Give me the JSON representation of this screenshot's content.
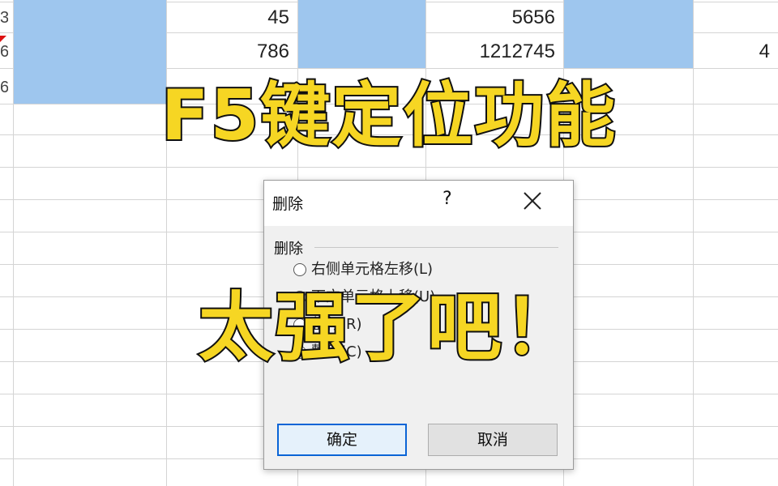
{
  "sheet": {
    "rows": [
      {
        "row_label": "3",
        "col_b": "45",
        "col_d": "5656",
        "col_f": ""
      },
      {
        "row_label": "6",
        "col_b": "786",
        "col_d": "1212745",
        "col_f": "4"
      },
      {
        "row_label": "6",
        "col_b": "",
        "col_d": "",
        "col_f": ""
      }
    ],
    "highlight_color": "#9ec6ee"
  },
  "dialog": {
    "title": "删除",
    "help_label": "?",
    "close_icon": "close-icon",
    "group_label": "删除",
    "options": [
      {
        "label": "右侧单元格左移(L)",
        "selected": false
      },
      {
        "label": "下方单元格上移(U)",
        "selected": true
      },
      {
        "label": "整行(R)",
        "selected": false
      },
      {
        "label": "整列(C)",
        "selected": false
      }
    ],
    "ok_label": "确定",
    "cancel_label": "取消"
  },
  "overlay": {
    "line1": "F5键定位功能",
    "line2": "太强了吧！",
    "text_color": "#f6d623"
  }
}
